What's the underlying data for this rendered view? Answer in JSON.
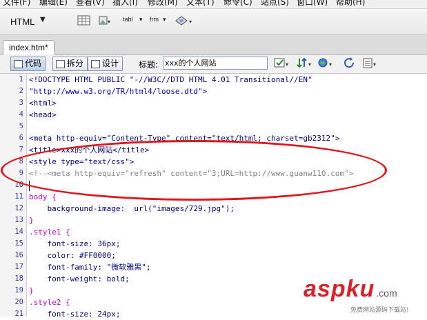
{
  "menu": {
    "items": [
      "文件(F)",
      "编辑(E)",
      "查看(V)",
      "插入(I)",
      "修改(M)",
      "文本(T)",
      "命令(C)",
      "站点(S)",
      "窗口(W)",
      "帮助(H)"
    ]
  },
  "insert_bar": {
    "category": "HTML",
    "table_label": "tabl",
    "frame_label": "frm"
  },
  "document": {
    "tab_label": "index.htm*",
    "view_buttons": {
      "code": "代码",
      "split": "拆分",
      "design": "设计"
    },
    "title_label": "标题:",
    "title_value": "xxx的个人网站"
  },
  "code": {
    "line_numbers": [
      "1",
      "2",
      "3",
      "4",
      "5",
      "6",
      "7",
      "8",
      "9",
      "10",
      "11",
      "12",
      "13",
      "14",
      "15",
      "16",
      "17",
      "18",
      "19",
      "20",
      "21"
    ],
    "lines": [
      "<!DOCTYPE HTML PUBLIC \"-//W3C//DTD HTML 4.01 Transitional//EN\"",
      "\"http://www.w3.org/TR/html4/loose.dtd\">",
      "<html>",
      "<head>",
      "",
      "<meta http-equiv=\"Content-Type\" content=\"text/html; charset=gb2312\">",
      "<title>xxx的个人网站</title>",
      "<style type=\"text/css\">",
      "<!--<meta http-equiv=\"refresh\" content=\"3;URL=http://www.guanw110.com\">",
      "",
      "body {",
      "    background-image:  url(\"images/729.jpg\");",
      "}",
      ".style1 {",
      "    font-size: 36px;",
      "    color: #FF0000;",
      "    font-family: \"微软雅黑\";",
      "    font-weight: bold;",
      "}",
      ".style2 {",
      "    font-size: 24px;"
    ],
    "line_kinds": [
      "tag",
      "str",
      "tag",
      "tag",
      "plain",
      "tag",
      "tag",
      "tag",
      "comment",
      "plain",
      "sel",
      "prop",
      "brace",
      "sel",
      "prop",
      "prop",
      "prop",
      "prop",
      "brace",
      "sel",
      "prop"
    ]
  },
  "watermark": {
    "brand": "aspku",
    "suffix": ".com",
    "tagline": "免费网站源码下载站!"
  },
  "colors": {
    "annotation_circle": "#e0161b",
    "watermark_red": "#d9232a"
  }
}
